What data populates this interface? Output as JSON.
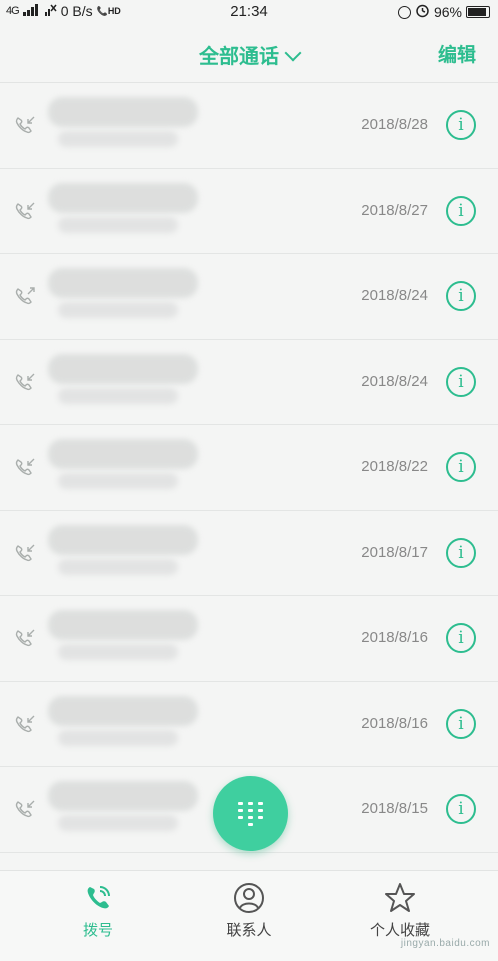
{
  "status_bar": {
    "network": "4G",
    "speed": "0 B/s",
    "hd": "HD",
    "time": "21:34",
    "battery": "96%",
    "battery_level": 0.96
  },
  "header": {
    "title": "全部通话",
    "edit_label": "编辑"
  },
  "calls": [
    {
      "date": "2018/8/28",
      "direction": "incoming"
    },
    {
      "date": "2018/8/27",
      "direction": "incoming"
    },
    {
      "date": "2018/8/24",
      "direction": "outgoing"
    },
    {
      "date": "2018/8/24",
      "direction": "incoming"
    },
    {
      "date": "2018/8/22",
      "direction": "incoming"
    },
    {
      "date": "2018/8/17",
      "direction": "incoming"
    },
    {
      "date": "2018/8/16",
      "direction": "incoming"
    },
    {
      "date": "2018/8/16",
      "direction": "incoming"
    },
    {
      "date": "2018/8/15",
      "direction": "incoming"
    }
  ],
  "tabs": [
    {
      "label": "拨号",
      "icon": "phone-icon",
      "active": true
    },
    {
      "label": "联系人",
      "icon": "person-icon",
      "active": false
    },
    {
      "label": "个人收藏",
      "icon": "star-icon",
      "active": false
    }
  ],
  "watermark": "jingyan.baidu.com",
  "colors": {
    "accent": "#2dbd8f",
    "fab": "#3fcf9f"
  }
}
